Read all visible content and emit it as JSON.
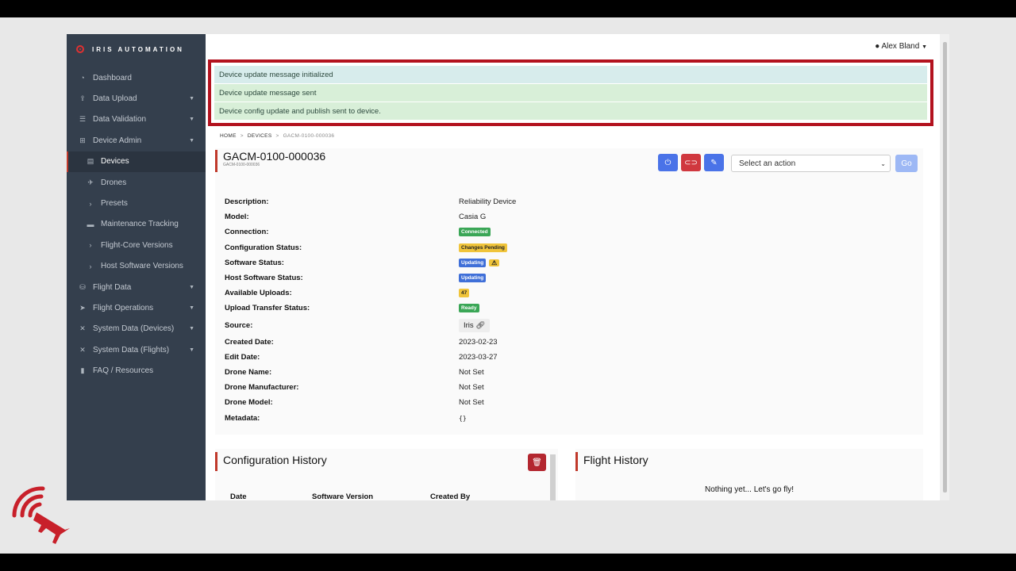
{
  "brand": "IRIS AUTOMATION",
  "user": {
    "name": "Alex Bland"
  },
  "sidebar": {
    "items": [
      {
        "label": "Dashboard",
        "icon": "dashboard-icon"
      },
      {
        "label": "Data Upload",
        "icon": "upload-icon",
        "caret": true
      },
      {
        "label": "Data Validation",
        "icon": "list-check-icon",
        "caret": true
      },
      {
        "label": "Device Admin",
        "icon": "network-icon",
        "caret": true
      },
      {
        "label": "Devices",
        "icon": "server-icon",
        "sub": true,
        "active": true
      },
      {
        "label": "Drones",
        "icon": "drone-icon",
        "sub": true
      },
      {
        "label": "Presets",
        "icon": "chevron-right-icon",
        "sub": true
      },
      {
        "label": "Maintenance Tracking",
        "icon": "wrench-icon",
        "sub": true
      },
      {
        "label": "Flight-Core Versions",
        "icon": "chevron-right-icon",
        "sub": true
      },
      {
        "label": "Host Software Versions",
        "icon": "chevron-right-icon",
        "sub": true
      },
      {
        "label": "Flight Data",
        "icon": "database-icon",
        "caret": true
      },
      {
        "label": "Flight Operations",
        "icon": "paper-plane-icon",
        "caret": true
      },
      {
        "label": "System Data (Devices)",
        "icon": "tools-icon",
        "caret": true
      },
      {
        "label": "System Data (Flights)",
        "icon": "tools-icon",
        "caret": true
      },
      {
        "label": "FAQ / Resources",
        "icon": "book-icon"
      }
    ]
  },
  "alerts": [
    {
      "text": "Device update message initialized",
      "type": "info"
    },
    {
      "text": "Device update message sent",
      "type": "ok"
    },
    {
      "text": "Device config update and publish sent to device.",
      "type": "ok"
    }
  ],
  "breadcrumb": {
    "home": "HOME",
    "devices": "DEVICES",
    "current": "GACM-0100-000036"
  },
  "device": {
    "title": "GACM-0100-000036",
    "subtitle": "GACM-0100-000036",
    "action_placeholder": "Select an action",
    "go_label": "Go",
    "description": "Reliability Device",
    "model": "Casia G",
    "connection": "Connected",
    "configuration_status": "Changes Pending",
    "software_status": "Updating",
    "software_warning": "⚠",
    "host_software_status": "Updating",
    "available_uploads": "47",
    "upload_transfer_status": "Ready",
    "source": "Iris",
    "created_date": "2023-02-23",
    "edit_date": "2023-03-27",
    "drone_name": "Not Set",
    "drone_manufacturer": "Not Set",
    "drone_model": "Not Set",
    "metadata": "{}"
  },
  "labels": {
    "description": "Description:",
    "model": "Model:",
    "connection": "Connection:",
    "configuration_status": "Configuration Status:",
    "software_status": "Software Status:",
    "host_software_status": "Host Software Status:",
    "available_uploads": "Available Uploads:",
    "upload_transfer_status": "Upload Transfer Status:",
    "source": "Source:",
    "created_date": "Created Date:",
    "edit_date": "Edit Date:",
    "drone_name": "Drone Name:",
    "drone_manufacturer": "Drone Manufacturer:",
    "drone_model": "Drone Model:",
    "metadata": "Metadata:"
  },
  "config_history": {
    "title": "Configuration History",
    "columns": [
      "Date",
      "Software Version",
      "Created By"
    ]
  },
  "flight_history": {
    "title": "Flight History",
    "empty": "Nothing yet... Let's go fly!"
  },
  "colors": {
    "sidebar": "#343f4d",
    "accent": "#c0392b",
    "primary": "#4a73e8",
    "danger": "#d0383f"
  }
}
